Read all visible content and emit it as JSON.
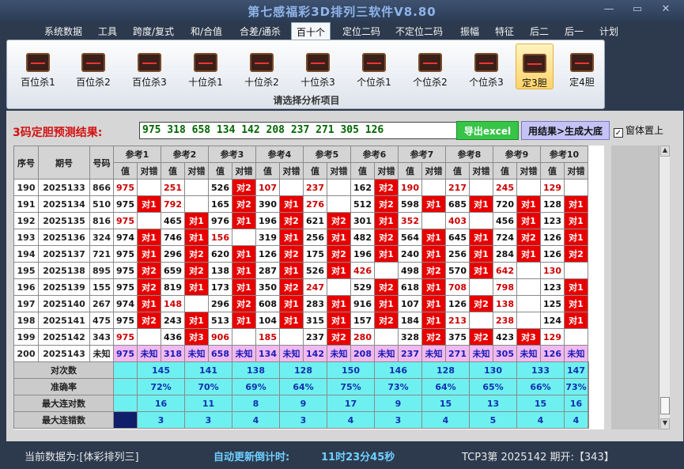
{
  "title": "第七感福彩3D排列三软件V8.80",
  "window_buttons": {
    "minimize": "—",
    "maximize": "▭",
    "close": "✕"
  },
  "menu": [
    "系统数据",
    "工具",
    "跨度/复式",
    "和/合值",
    "合差/通杀",
    "百十个",
    "定位二码",
    "不定位二码",
    "振幅",
    "特征",
    "后二",
    "后一",
    "计划"
  ],
  "active_menu": "百十个",
  "ribbon": {
    "items": [
      "百位杀1",
      "百位杀2",
      "百位杀3",
      "十位杀1",
      "十位杀2",
      "十位杀3",
      "个位杀1",
      "个位杀2",
      "个位杀3",
      "定3胆",
      "定4胆"
    ],
    "selected": "定3胆",
    "caption": "请选择分析项目"
  },
  "prediction": {
    "label": "3码定胆预测结果:",
    "value": "975 318 658 134 142 208 237 271 305 126",
    "excel_button": "导出excel",
    "generate_button": "用结果>生成大底",
    "topmost_checkbox": {
      "label": "窗体置上",
      "checked": true
    }
  },
  "table": {
    "col_headers": {
      "seq": "序号",
      "period": "期号",
      "number": "号码",
      "val": "值",
      "hit": "对错"
    },
    "ref_headers": [
      "参考1",
      "参考2",
      "参考3",
      "参考4",
      "参考5",
      "参考6",
      "参考7",
      "参考8",
      "参考9",
      "参考10"
    ],
    "rows": [
      {
        "seq": "190",
        "period": "2025133",
        "num": "866",
        "cells": [
          [
            "975",
            "",
            "r"
          ],
          [
            "251",
            "",
            "r"
          ],
          [
            "526",
            "对2",
            "b"
          ],
          [
            "107",
            "",
            "r"
          ],
          [
            "237",
            "",
            "r"
          ],
          [
            "162",
            "对2",
            "b"
          ],
          [
            "190",
            "",
            "r"
          ],
          [
            "217",
            "",
            "r"
          ],
          [
            "245",
            "",
            "r"
          ],
          [
            "129",
            "",
            "r"
          ]
        ]
      },
      {
        "seq": "191",
        "period": "2025134",
        "num": "510",
        "cells": [
          [
            "975",
            "对1",
            "b"
          ],
          [
            "792",
            "",
            "r"
          ],
          [
            "165",
            "对2",
            "b"
          ],
          [
            "390",
            "对1",
            "b"
          ],
          [
            "276",
            "",
            "r"
          ],
          [
            "512",
            "对2",
            "b"
          ],
          [
            "598",
            "对1",
            "b"
          ],
          [
            "685",
            "对1",
            "b"
          ],
          [
            "720",
            "对1",
            "b"
          ],
          [
            "128",
            "对1",
            "b"
          ]
        ]
      },
      {
        "seq": "192",
        "period": "2025135",
        "num": "816",
        "cells": [
          [
            "975",
            "",
            "r"
          ],
          [
            "465",
            "对1",
            "b"
          ],
          [
            "976",
            "对1",
            "b"
          ],
          [
            "196",
            "对2",
            "b"
          ],
          [
            "621",
            "对2",
            "b"
          ],
          [
            "301",
            "对1",
            "b"
          ],
          [
            "352",
            "",
            "r"
          ],
          [
            "403",
            "",
            "r"
          ],
          [
            "456",
            "对1",
            "b"
          ],
          [
            "123",
            "对1",
            "b"
          ]
        ]
      },
      {
        "seq": "193",
        "period": "2025136",
        "num": "324",
        "cells": [
          [
            "974",
            "对1",
            "b"
          ],
          [
            "746",
            "对1",
            "b"
          ],
          [
            "156",
            "",
            "r"
          ],
          [
            "319",
            "对1",
            "b"
          ],
          [
            "256",
            "对1",
            "b"
          ],
          [
            "482",
            "对2",
            "b"
          ],
          [
            "564",
            "对1",
            "b"
          ],
          [
            "645",
            "对1",
            "b"
          ],
          [
            "724",
            "对2",
            "b"
          ],
          [
            "126",
            "对1",
            "b"
          ]
        ]
      },
      {
        "seq": "194",
        "period": "2025137",
        "num": "721",
        "cells": [
          [
            "975",
            "对1",
            "b"
          ],
          [
            "296",
            "对2",
            "b"
          ],
          [
            "620",
            "对1",
            "b"
          ],
          [
            "126",
            "对2",
            "b"
          ],
          [
            "175",
            "对2",
            "b"
          ],
          [
            "196",
            "对1",
            "b"
          ],
          [
            "240",
            "对1",
            "b"
          ],
          [
            "256",
            "对1",
            "b"
          ],
          [
            "284",
            "对1",
            "b"
          ],
          [
            "126",
            "对2",
            "b"
          ]
        ]
      },
      {
        "seq": "195",
        "period": "2025138",
        "num": "895",
        "cells": [
          [
            "975",
            "对2",
            "b"
          ],
          [
            "659",
            "对2",
            "b"
          ],
          [
            "138",
            "对1",
            "b"
          ],
          [
            "287",
            "对1",
            "b"
          ],
          [
            "526",
            "对1",
            "b"
          ],
          [
            "426",
            "",
            "r"
          ],
          [
            "498",
            "对2",
            "b"
          ],
          [
            "570",
            "对1",
            "b"
          ],
          [
            "642",
            "",
            "r"
          ],
          [
            "130",
            "",
            "r"
          ]
        ]
      },
      {
        "seq": "196",
        "period": "2025139",
        "num": "155",
        "cells": [
          [
            "975",
            "对2",
            "b"
          ],
          [
            "819",
            "对1",
            "b"
          ],
          [
            "173",
            "对1",
            "b"
          ],
          [
            "350",
            "对2",
            "b"
          ],
          [
            "247",
            "",
            "r"
          ],
          [
            "529",
            "对2",
            "b"
          ],
          [
            "618",
            "对1",
            "b"
          ],
          [
            "708",
            "",
            "r"
          ],
          [
            "798",
            "",
            "r"
          ],
          [
            "123",
            "对1",
            "b"
          ]
        ]
      },
      {
        "seq": "197",
        "period": "2025140",
        "num": "267",
        "cells": [
          [
            "974",
            "对1",
            "b"
          ],
          [
            "148",
            "",
            "r"
          ],
          [
            "296",
            "对2",
            "b"
          ],
          [
            "608",
            "对1",
            "b"
          ],
          [
            "283",
            "对1",
            "b"
          ],
          [
            "916",
            "对1",
            "b"
          ],
          [
            "107",
            "对1",
            "b"
          ],
          [
            "126",
            "对2",
            "b"
          ],
          [
            "138",
            "",
            "r"
          ],
          [
            "125",
            "对1",
            "b"
          ]
        ]
      },
      {
        "seq": "198",
        "period": "2025141",
        "num": "475",
        "cells": [
          [
            "975",
            "对2",
            "b"
          ],
          [
            "243",
            "对1",
            "b"
          ],
          [
            "513",
            "对1",
            "b"
          ],
          [
            "104",
            "对1",
            "b"
          ],
          [
            "315",
            "对1",
            "b"
          ],
          [
            "157",
            "对2",
            "b"
          ],
          [
            "184",
            "对1",
            "b"
          ],
          [
            "213",
            "",
            "r"
          ],
          [
            "238",
            "",
            "r"
          ],
          [
            "124",
            "对1",
            "b"
          ]
        ]
      },
      {
        "seq": "199",
        "period": "2025142",
        "num": "343",
        "cells": [
          [
            "975",
            "",
            "r"
          ],
          [
            "436",
            "对3",
            "b"
          ],
          [
            "906",
            "",
            "r"
          ],
          [
            "185",
            "",
            "r"
          ],
          [
            "237",
            "对2",
            "b"
          ],
          [
            "280",
            "",
            "r"
          ],
          [
            "328",
            "对2",
            "b"
          ],
          [
            "375",
            "对2",
            "b"
          ],
          [
            "423",
            "对3",
            "b"
          ],
          [
            "129",
            "",
            "r"
          ]
        ]
      }
    ],
    "future_row": {
      "seq": "200",
      "period": "2025143",
      "num": "未知",
      "vals": [
        "975",
        "318",
        "658",
        "134",
        "142",
        "208",
        "237",
        "271",
        "305",
        "126"
      ],
      "status": "未知"
    },
    "stats": [
      {
        "label": "对次数",
        "values": [
          "145",
          "141",
          "138",
          "128",
          "150",
          "146",
          "128",
          "130",
          "133",
          "147"
        ]
      },
      {
        "label": "准确率",
        "values": [
          "72%",
          "70%",
          "69%",
          "64%",
          "75%",
          "73%",
          "64%",
          "65%",
          "66%",
          "73%"
        ]
      },
      {
        "label": "最大连对数",
        "values": [
          "16",
          "11",
          "8",
          "9",
          "17",
          "9",
          "15",
          "13",
          "15",
          "16"
        ]
      },
      {
        "label": "最大连错数",
        "values": [
          "3",
          "3",
          "4",
          "3",
          "4",
          "3",
          "4",
          "5",
          "4",
          "4"
        ]
      }
    ]
  },
  "status": {
    "current_data": "当前数据为:[体彩排列三]",
    "countdown_label": "自动更新倒计时:",
    "countdown_value": "11时23分45秒",
    "period_info": "TCP3第 2025142 期开:【343】"
  },
  "colors": {
    "hit": "#e80000",
    "miss_text": "#cc0000",
    "stat_bg": "#6ff0f0",
    "future_bg": "#f1b9ef",
    "accent_green": "#37c447"
  }
}
